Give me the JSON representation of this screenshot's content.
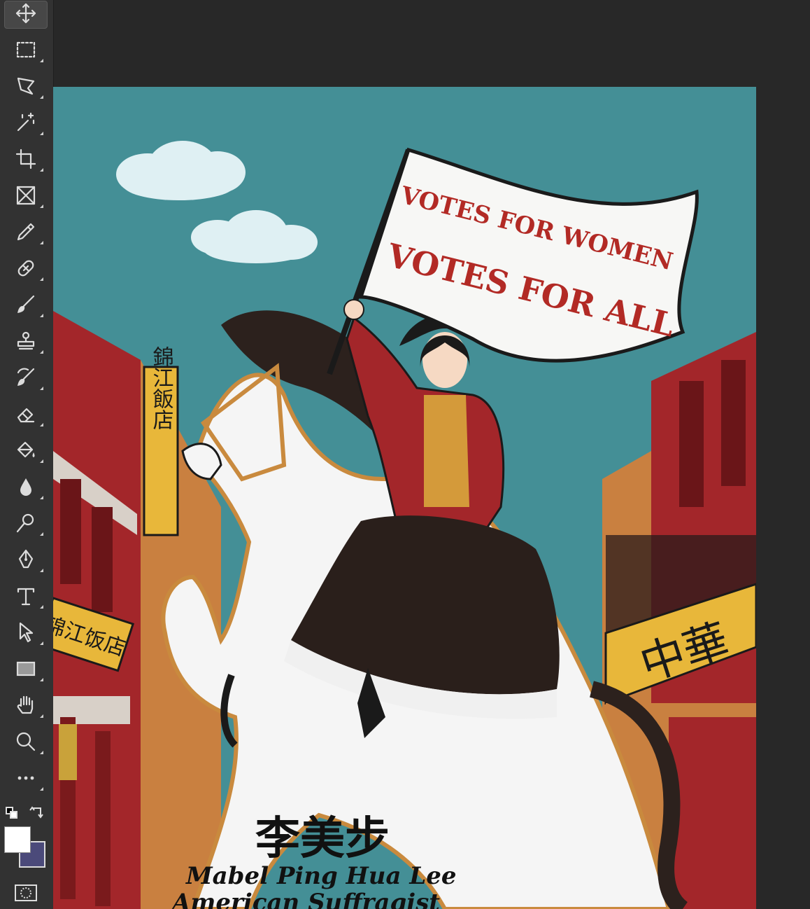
{
  "toolbar": {
    "tools": [
      {
        "name": "move-tool",
        "icon": "move-icon",
        "active": true
      },
      {
        "name": "rectangular-marquee-tool",
        "icon": "marquee-icon"
      },
      {
        "name": "lasso-tool",
        "icon": "polygonal-lasso-icon"
      },
      {
        "name": "magic-wand-tool",
        "icon": "magic-wand-icon"
      },
      {
        "name": "crop-tool",
        "icon": "crop-icon"
      },
      {
        "name": "frame-tool",
        "icon": "frame-icon"
      },
      {
        "name": "eyedropper-tool",
        "icon": "eyedropper-icon"
      },
      {
        "name": "healing-brush-tool",
        "icon": "bandage-icon"
      },
      {
        "name": "brush-tool",
        "icon": "brush-icon"
      },
      {
        "name": "clone-stamp-tool",
        "icon": "stamp-icon"
      },
      {
        "name": "history-brush-tool",
        "icon": "history-brush-icon"
      },
      {
        "name": "eraser-tool",
        "icon": "eraser-icon"
      },
      {
        "name": "paint-bucket-tool",
        "icon": "paint-bucket-icon"
      },
      {
        "name": "blur-tool",
        "icon": "drop-icon"
      },
      {
        "name": "dodge-tool",
        "icon": "dodge-icon"
      },
      {
        "name": "pen-tool",
        "icon": "pen-icon"
      },
      {
        "name": "type-tool",
        "icon": "type-icon"
      },
      {
        "name": "path-selection-tool",
        "icon": "arrow-cursor-icon"
      },
      {
        "name": "rectangle-tool",
        "icon": "rectangle-icon"
      },
      {
        "name": "hand-tool",
        "icon": "hand-icon"
      },
      {
        "name": "zoom-tool",
        "icon": "zoom-icon"
      },
      {
        "name": "edit-toolbar",
        "icon": "more-icon"
      }
    ],
    "foreground_color": "#ffffff",
    "background_color": "#4b4a7a"
  },
  "canvas": {
    "background_color": "#448f96",
    "flag_line1": "VOTES FOR WOMEN",
    "flag_line2": "VOTES FOR ALL",
    "sign_vertical": "錦江飯店",
    "sign_left": "锦江饭店",
    "sign_right": "中華",
    "chinese_name": "李美步",
    "english_name": "Mabel Ping Hua Lee",
    "subtitle": "American Suffragist"
  }
}
